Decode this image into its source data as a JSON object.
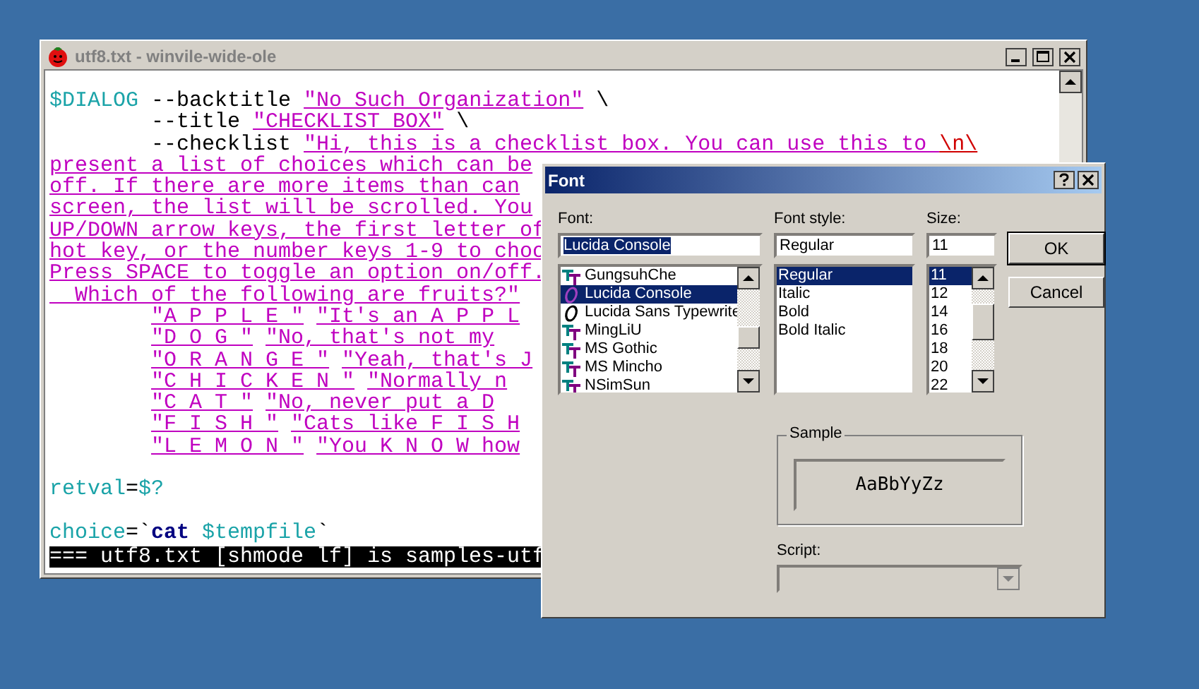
{
  "editor": {
    "title": "utf8.txt - winvile-wide-ole",
    "lines": [
      {
        "segments": [
          {
            "kind": "var",
            "text": "$DIALOG"
          },
          {
            "kind": "plain",
            "text": " --backtitle "
          },
          {
            "kind": "string",
            "text": "\"No Such Organization\""
          },
          {
            "kind": "plain",
            "text": " \\"
          }
        ]
      },
      {
        "segments": [
          {
            "kind": "plain",
            "text": "        --title "
          },
          {
            "kind": "string",
            "text": "\"CHECKLIST BOX\""
          },
          {
            "kind": "plain",
            "text": " \\"
          }
        ]
      },
      {
        "segments": [
          {
            "kind": "plain",
            "text": "        --checklist "
          },
          {
            "kind": "string",
            "text": "\"Hi, this is a checklist box. You can use this to "
          },
          {
            "kind": "escape",
            "text": "\\n\\"
          }
        ]
      },
      {
        "segments": [
          {
            "kind": "string",
            "text": "present a list of choices which can be"
          }
        ]
      },
      {
        "segments": [
          {
            "kind": "string",
            "text": "off. If there are more items than can"
          }
        ]
      },
      {
        "segments": [
          {
            "kind": "string",
            "text": "screen, the list will be scrolled. You"
          }
        ]
      },
      {
        "segments": [
          {
            "kind": "string",
            "text": "UP/DOWN arrow keys, the first letter of"
          }
        ]
      },
      {
        "segments": [
          {
            "kind": "string",
            "text": "hot key, or the number keys 1-9 to choo"
          }
        ]
      },
      {
        "segments": [
          {
            "kind": "string",
            "text": "Press SPACE to toggle an option on/off."
          }
        ]
      },
      {
        "segments": [
          {
            "kind": "string",
            "text": "  Which of the following are fruits?\""
          }
        ]
      },
      {
        "kind": "item",
        "segments": [
          {
            "kind": "string",
            "text": "\"A P P L E \""
          },
          {
            "kind": "string",
            "text": "\"It's an A P P L"
          }
        ]
      },
      {
        "kind": "item",
        "segments": [
          {
            "kind": "string",
            "text": "\"D O G \""
          },
          {
            "kind": "string",
            "text": "\"No, that's not my"
          }
        ]
      },
      {
        "kind": "item",
        "segments": [
          {
            "kind": "string",
            "text": "\"O R A N G E \""
          },
          {
            "kind": "string",
            "text": "\"Yeah, that's J"
          }
        ]
      },
      {
        "kind": "item",
        "segments": [
          {
            "kind": "string",
            "text": "\"C H I C K E N \""
          },
          {
            "kind": "string",
            "text": "\"Normally n"
          }
        ]
      },
      {
        "kind": "item",
        "segments": [
          {
            "kind": "string",
            "text": "\"C A T \""
          },
          {
            "kind": "string",
            "text": "\"No, never put a D"
          }
        ]
      },
      {
        "kind": "item",
        "segments": [
          {
            "kind": "string",
            "text": "\"F I S H \""
          },
          {
            "kind": "string",
            "text": "\"Cats like F I S H"
          }
        ]
      },
      {
        "kind": "item",
        "segments": [
          {
            "kind": "string",
            "text": "\"L E M O N \""
          },
          {
            "kind": "string",
            "text": "\"You K N O W how"
          }
        ]
      },
      {
        "kind": "blank"
      },
      {
        "segments": [
          {
            "kind": "var",
            "text": "retval"
          },
          {
            "kind": "plain",
            "text": "="
          },
          {
            "kind": "var",
            "text": "$?"
          }
        ]
      },
      {
        "kind": "blank"
      },
      {
        "segments": [
          {
            "kind": "var",
            "text": "choice"
          },
          {
            "kind": "plain",
            "text": "=`"
          },
          {
            "kind": "keyword",
            "text": "cat"
          },
          {
            "kind": "var",
            "text": "$tempfile"
          },
          {
            "kind": "plain",
            "text": "`"
          }
        ]
      }
    ],
    "status_line": "=== utf8.txt [shmode lf] is samples-utf"
  },
  "font_dialog": {
    "title": "Font",
    "font": {
      "label": "Font:",
      "value": "Lucida Console",
      "value_highlighted": true,
      "items": [
        {
          "name": "GungsuhChe",
          "kind": "truetype",
          "selected": false
        },
        {
          "name": "Lucida Console",
          "kind": "opentype",
          "selected": true
        },
        {
          "name": "Lucida Sans Typewrite",
          "kind": "opentype",
          "selected": false
        },
        {
          "name": "MingLiU",
          "kind": "truetype",
          "selected": false
        },
        {
          "name": "MS Gothic",
          "kind": "truetype",
          "selected": false
        },
        {
          "name": "MS Mincho",
          "kind": "truetype",
          "selected": false
        },
        {
          "name": "NSimSun",
          "kind": "truetype",
          "selected": false
        }
      ]
    },
    "style": {
      "label": "Font style:",
      "value": "Regular",
      "items": [
        {
          "label": "Regular",
          "selected": true
        },
        {
          "label": "Italic",
          "selected": false
        },
        {
          "label": "Bold",
          "selected": false
        },
        {
          "label": "Bold Italic",
          "selected": false
        }
      ]
    },
    "size": {
      "label": "Size:",
      "value": "11",
      "items": [
        {
          "label": "11",
          "selected": true
        },
        {
          "label": "12",
          "selected": false
        },
        {
          "label": "14",
          "selected": false
        },
        {
          "label": "16",
          "selected": false
        },
        {
          "label": "18",
          "selected": false
        },
        {
          "label": "20",
          "selected": false
        },
        {
          "label": "22",
          "selected": false
        }
      ]
    },
    "buttons": [
      {
        "label": "OK",
        "default": true
      },
      {
        "label": "Cancel",
        "default": false
      }
    ],
    "sample": {
      "label": "Sample",
      "text": "AaBbYyZz"
    },
    "script": {
      "label": "Script:",
      "disabled": true
    }
  }
}
